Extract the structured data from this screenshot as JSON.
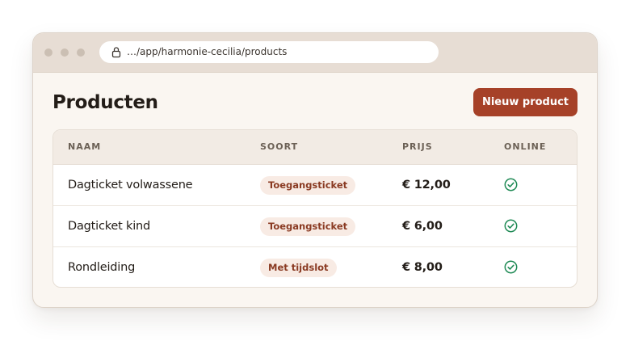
{
  "browser": {
    "url": "…/app/harmonie-cecilia/products",
    "controls": [
      "close-dot",
      "minimize-dot",
      "maximize-dot"
    ],
    "lock_icon": "lock-icon"
  },
  "page": {
    "title": "Producten",
    "new_button_label": "Nieuw product"
  },
  "table": {
    "headers": {
      "name": "NAAM",
      "type": "SOORT",
      "price": "PRIJS",
      "online": "ONLINE"
    },
    "rows": [
      {
        "name": "Dagticket volwassene",
        "type": "Toegangsticket",
        "price": "€ 12,00",
        "online": true,
        "online_icon": "check-circle-icon"
      },
      {
        "name": "Dagticket kind",
        "type": "Toegangsticket",
        "price": "€ 6,00",
        "online": true,
        "online_icon": "check-circle-icon"
      },
      {
        "name": "Rondleiding",
        "type": "Met tijdslot",
        "price": "€ 8,00",
        "online": true,
        "online_icon": "check-circle-icon"
      }
    ]
  },
  "colors": {
    "accent": "#a64128",
    "badge_bg": "#f8ebe4",
    "badge_text": "#8a3a22",
    "online_green": "#1f8a55"
  }
}
